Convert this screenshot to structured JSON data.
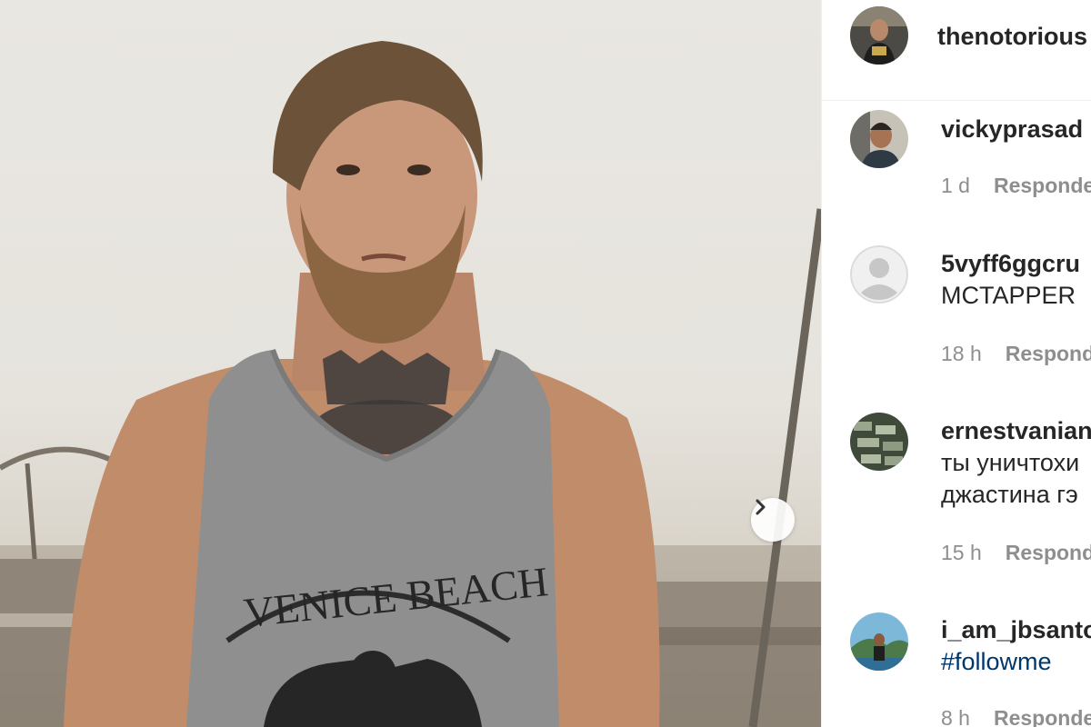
{
  "post": {
    "author": "thenotorious",
    "next_icon": "chevron-right-icon"
  },
  "comments": [
    {
      "username": "vickyprasad",
      "text": "",
      "time": "1 d",
      "reply_label": "Responde"
    },
    {
      "username": "5vyff6ggcru",
      "text": "MCTAPPER",
      "time": "18 h",
      "reply_label": "Responde"
    },
    {
      "username": "ernestvanian",
      "text_lines": [
        "ты уничтохи",
        "джастина гэ"
      ],
      "time": "15 h",
      "reply_label": "Responde"
    },
    {
      "username": "i_am_jbsanto",
      "text": "#followme",
      "time": "8 h",
      "reply_label": "Responde"
    }
  ],
  "colors": {
    "text": "#262626",
    "meta": "#8e8e8e",
    "hashtag": "#00376b",
    "border": "#efefef"
  }
}
